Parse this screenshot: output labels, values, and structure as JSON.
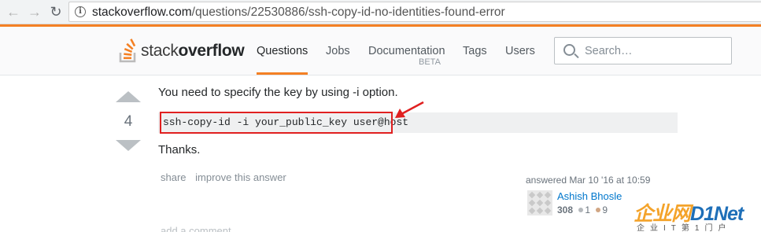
{
  "browser": {
    "url_host": "stackoverflow.com",
    "url_path": "/questions/22530886/ssh-copy-id-no-identities-found-error"
  },
  "header": {
    "logo_text_light": "stack",
    "logo_text_bold": "overflow",
    "nav": {
      "questions": "Questions",
      "jobs": "Jobs",
      "documentation": "Documentation",
      "documentation_badge": "BETA",
      "tags": "Tags",
      "users": "Users"
    },
    "search_placeholder": "Search…",
    "accent_color": "#f48024"
  },
  "answer": {
    "vote_count": "4",
    "intro": "You need to specify the key by using -i option.",
    "code": "ssh-copy-id -i your_public_key user@host",
    "thanks": "Thanks.",
    "menu": {
      "share": "share",
      "improve": "improve this answer"
    },
    "add_comment": "add a comment",
    "highlight_color": "#e02020"
  },
  "user_card": {
    "answered": "answered Mar 10 '16 at 10:59",
    "name": "Ashish Bhosle",
    "reputation": "308",
    "silver_badges": "1",
    "bronze_badges": "9"
  },
  "watermark": {
    "brand_cn": "企业网",
    "brand_en": "D1Net",
    "tagline": "企业IT第1门户"
  }
}
